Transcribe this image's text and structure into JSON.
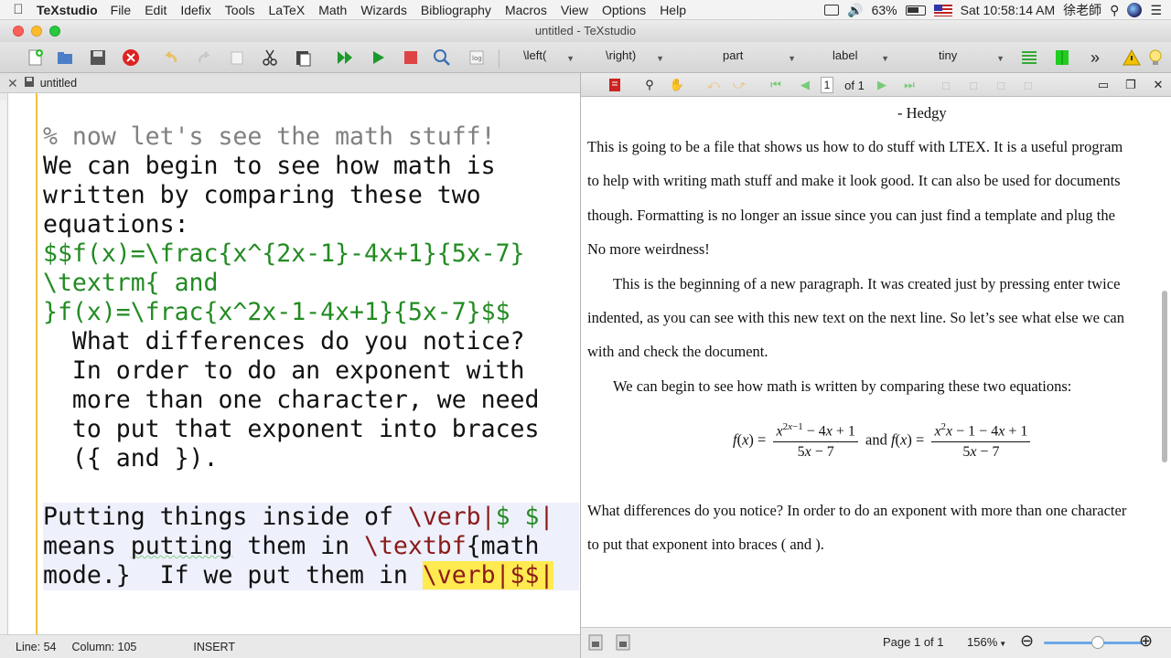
{
  "menubar": {
    "app_name": "TeXstudio",
    "items": [
      "File",
      "Edit",
      "Idefix",
      "Tools",
      "LaTeX",
      "Math",
      "Wizards",
      "Bibliography",
      "Macros",
      "View",
      "Options",
      "Help"
    ],
    "battery": "63%",
    "clock": "Sat 10:58:14 AM",
    "user": "徐老師"
  },
  "window": {
    "title": "untitled - TeXstudio"
  },
  "toolbar": {
    "combos": [
      "\\left(",
      "\\right)",
      "part",
      "label",
      "tiny"
    ],
    "overflow": "»"
  },
  "editor": {
    "tab_label": "untitled",
    "lines": [
      [
        {
          "t": "% now let's see the math stuff!",
          "c": "cmt"
        }
      ],
      [
        {
          "t": "We can begin to see how math is",
          "c": "blk"
        }
      ],
      [
        {
          "t": "written by comparing these two",
          "c": "blk"
        }
      ],
      [
        {
          "t": "equations:",
          "c": "blk"
        }
      ],
      [
        {
          "t": "$$f(x)=\\frac{x^{2x-1}-4x+1}{5x-7}",
          "c": "math"
        }
      ],
      [
        {
          "t": "\\textrm{ and",
          "c": "math"
        }
      ],
      [
        {
          "t": "}f(x)=\\frac{x^2x-1-4x+1}{5x-7}$$",
          "c": "math"
        }
      ],
      [
        {
          "t": "  What differences do you notice?",
          "c": "blk"
        }
      ],
      [
        {
          "t": "  In order to do an exponent with",
          "c": "blk"
        }
      ],
      [
        {
          "t": "  more than one character, we need",
          "c": "blk"
        }
      ],
      [
        {
          "t": "  to put that exponent into braces",
          "c": "blk"
        }
      ],
      [
        {
          "t": "  ({ and }).",
          "c": "blk"
        }
      ],
      [
        {
          "t": "",
          "c": "blk"
        }
      ],
      [
        {
          "t": "Putting things inside of ",
          "c": "blk"
        },
        {
          "t": "\\verb|",
          "c": "cmd"
        },
        {
          "t": "$ $",
          "c": "math"
        },
        {
          "t": "|",
          "c": "cmd"
        }
      ],
      [
        {
          "t": "means ",
          "c": "blk"
        },
        {
          "t": "putting",
          "c": "blk wavy"
        },
        {
          "t": " them in ",
          "c": "blk"
        },
        {
          "t": "\\textbf",
          "c": "cmd"
        },
        {
          "t": "{math",
          "c": "blk"
        }
      ],
      [
        {
          "t": "mode.}  If we put them in ",
          "c": "blk"
        },
        {
          "t": "\\verb|$$|",
          "c": "cmd hl"
        }
      ]
    ]
  },
  "statusbar": {
    "line": "Line: 54",
    "column": "Column: 105",
    "mode": "INSERT"
  },
  "pdf": {
    "page_current": "1",
    "page_of": "of  1",
    "author_line": "- Hedgy",
    "para1": [
      "This is going to be a file that shows us how to do stuff with L",
      "to help with writing math stuff and make it look good. It can also be used for documents",
      "though. Formatting is no longer an issue since you can just find a template and plug the",
      "No more weirdness!"
    ],
    "para1_tail": "TEX. It is a useful program",
    "para2": [
      "This is the beginning of a new paragraph. It was created just by pressing enter twice",
      "indented, as you can see with this new text on the next line. So let’s see what else we can",
      "with and check the document."
    ],
    "para3": "We can begin to see how math is written by comparing these two equations:",
    "eq_and": "and",
    "para4": [
      "What differences do you notice? In order to do an exponent with more than one character",
      "to put that exponent into braces ( and )."
    ],
    "status_page": "Page 1 of 1",
    "zoom": "156%"
  }
}
